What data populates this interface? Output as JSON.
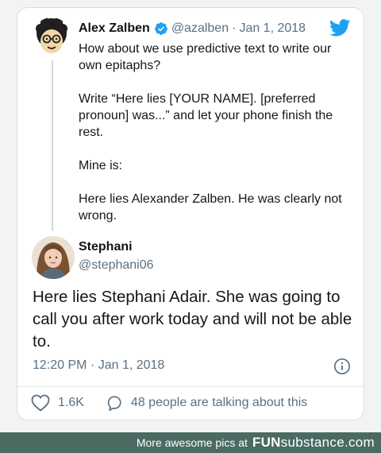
{
  "tweet": {
    "author_name": "Alex Zalben",
    "author_handle": "@azalben",
    "separator": "·",
    "date": "Jan 1, 2018",
    "paragraphs": [
      "How about we use predictive text to write our own epitaphs?",
      "Write “Here lies [YOUR NAME]. [preferred pronoun] was...” and let your phone finish the rest.",
      "Mine is:",
      "Here lies Alexander Zalben. He was clearly not wrong."
    ]
  },
  "reply": {
    "author_name": "Stephani",
    "author_handle": "@stephani06",
    "text": "Here lies Stephani Adair. She was going to call you after work today and will not be able to.",
    "timestamp": "12:20 PM · Jan 1, 2018",
    "likes": "1.6K",
    "talking": "48 people are talking about this"
  },
  "footer": {
    "more_text": "More awesome pics at",
    "brand_bold": "FUN",
    "brand_light": "substance",
    "brand_tld": ".com"
  },
  "colors": {
    "twitter_blue": "#1da1f2",
    "muted_text": "#5b7083",
    "footer_bg": "#4a6a62"
  },
  "icons": [
    "verified-badge-icon",
    "twitter-bird-icon",
    "info-icon",
    "heart-icon",
    "reply-bubble-icon"
  ]
}
